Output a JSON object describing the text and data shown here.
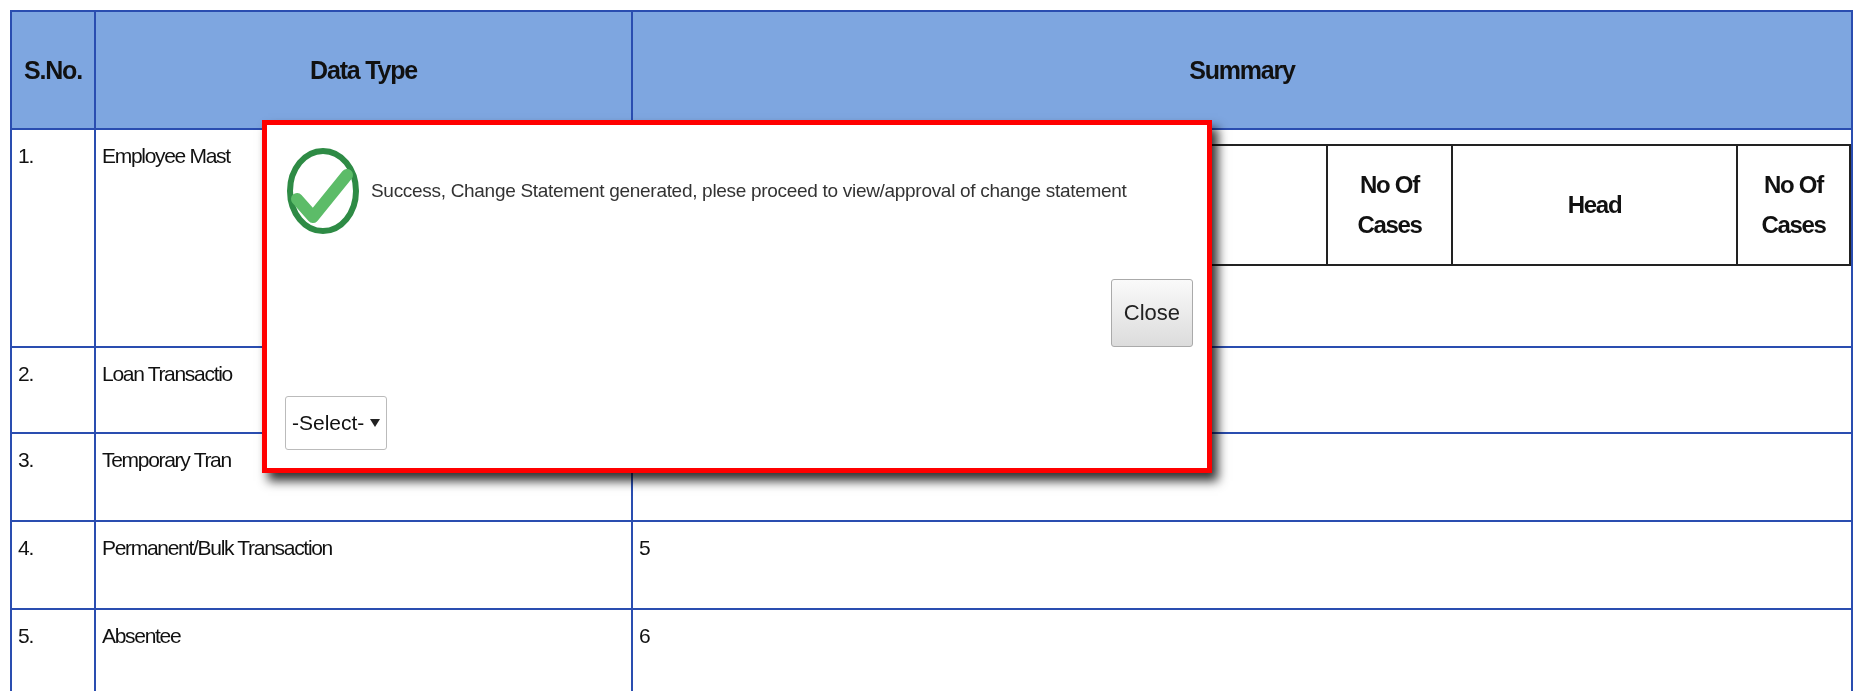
{
  "table": {
    "columns": [
      "S.No.",
      "Data Type",
      "Summary"
    ],
    "rows": [
      {
        "sno": "1.",
        "data_type": "Employee Mast",
        "summary_columns": [
          "No Of Cases",
          "Head",
          "No Of Cases"
        ]
      },
      {
        "sno": "2.",
        "data_type": "Loan Transactio"
      },
      {
        "sno": "3.",
        "data_type": "Temporary Tran"
      },
      {
        "sno": "4.",
        "data_type": "Permanent/Bulk Transaction",
        "summary": "5"
      },
      {
        "sno": "5.",
        "data_type": "Absentee",
        "summary": "6"
      }
    ]
  },
  "dialog": {
    "message": "Success, Change Statement generated, plese proceed to view/approval of change statement",
    "close_button": "Close",
    "select": {
      "value": "-Select-"
    }
  }
}
